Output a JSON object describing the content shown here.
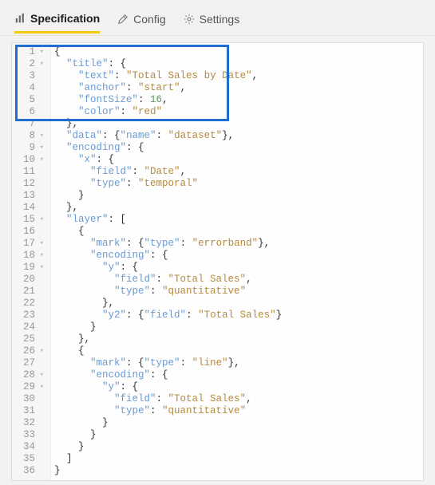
{
  "tabs": {
    "spec": {
      "label": "Specification"
    },
    "config": {
      "label": "Config"
    },
    "settings": {
      "label": "Settings"
    }
  },
  "gutter": {
    "lines": [
      "1",
      "2",
      "3",
      "4",
      "5",
      "6",
      "7",
      "8",
      "9",
      "10",
      "11",
      "12",
      "13",
      "14",
      "15",
      "16",
      "17",
      "18",
      "19",
      "20",
      "21",
      "22",
      "23",
      "24",
      "25",
      "26",
      "27",
      "28",
      "29",
      "30",
      "31",
      "32",
      "33",
      "34",
      "35",
      "36"
    ],
    "foldOn": [
      1,
      2,
      8,
      9,
      10,
      15,
      17,
      18,
      19,
      26,
      28,
      29
    ]
  },
  "code": {
    "l1": "{",
    "l2": {
      "indent": "  ",
      "key": "\"title\"",
      "sep": ": {"
    },
    "l3": {
      "indent": "    ",
      "key": "\"text\"",
      "sep": ": ",
      "val": "\"Total Sales by Date\"",
      "tail": ","
    },
    "l4": {
      "indent": "    ",
      "key": "\"anchor\"",
      "sep": ": ",
      "val": "\"start\"",
      "tail": ","
    },
    "l5": {
      "indent": "    ",
      "key": "\"fontSize\"",
      "sep": ": ",
      "num": "16",
      "tail": ","
    },
    "l6": {
      "indent": "    ",
      "key": "\"color\"",
      "sep": ": ",
      "val": "\"red\""
    },
    "l7": "  },",
    "l8": {
      "indent": "  ",
      "key": "\"data\"",
      "sep": ": {",
      "key2": "\"name\"",
      "sep2": ": ",
      "val": "\"dataset\"",
      "tail": "},"
    },
    "l9": {
      "indent": "  ",
      "key": "\"encoding\"",
      "sep": ": {"
    },
    "l10": {
      "indent": "    ",
      "key": "\"x\"",
      "sep": ": {"
    },
    "l11": {
      "indent": "      ",
      "key": "\"field\"",
      "sep": ": ",
      "val": "\"Date\"",
      "tail": ","
    },
    "l12": {
      "indent": "      ",
      "key": "\"type\"",
      "sep": ": ",
      "val": "\"temporal\""
    },
    "l13": "    }",
    "l14": "  },",
    "l15": {
      "indent": "  ",
      "key": "\"layer\"",
      "sep": ": ["
    },
    "l16": "    {",
    "l17": {
      "indent": "      ",
      "key": "\"mark\"",
      "sep": ": {",
      "key2": "\"type\"",
      "sep2": ": ",
      "val": "\"errorband\"",
      "tail": "},"
    },
    "l18": {
      "indent": "      ",
      "key": "\"encoding\"",
      "sep": ": {"
    },
    "l19": {
      "indent": "        ",
      "key": "\"y\"",
      "sep": ": {"
    },
    "l20": {
      "indent": "          ",
      "key": "\"field\"",
      "sep": ": ",
      "val": "\"Total Sales\"",
      "tail": ","
    },
    "l21": {
      "indent": "          ",
      "key": "\"type\"",
      "sep": ": ",
      "val": "\"quantitative\""
    },
    "l22": "        },",
    "l23": {
      "indent": "        ",
      "key": "\"y2\"",
      "sep": ": {",
      "key2": "\"field\"",
      "sep2": ": ",
      "val": "\"Total Sales\"",
      "tail": "}"
    },
    "l24": "      }",
    "l25": "    },",
    "l26": "    {",
    "l27": {
      "indent": "      ",
      "key": "\"mark\"",
      "sep": ": {",
      "key2": "\"type\"",
      "sep2": ": ",
      "val": "\"line\"",
      "tail": "},"
    },
    "l28": {
      "indent": "      ",
      "key": "\"encoding\"",
      "sep": ": {"
    },
    "l29": {
      "indent": "        ",
      "key": "\"y\"",
      "sep": ": {"
    },
    "l30": {
      "indent": "          ",
      "key": "\"field\"",
      "sep": ": ",
      "val": "\"Total Sales\"",
      "tail": ","
    },
    "l31": {
      "indent": "          ",
      "key": "\"type\"",
      "sep": ": ",
      "val": "\"quantitative\""
    },
    "l32": "        }",
    "l33": "      }",
    "l34": "    }",
    "l35": "  ]",
    "l36": "}"
  }
}
